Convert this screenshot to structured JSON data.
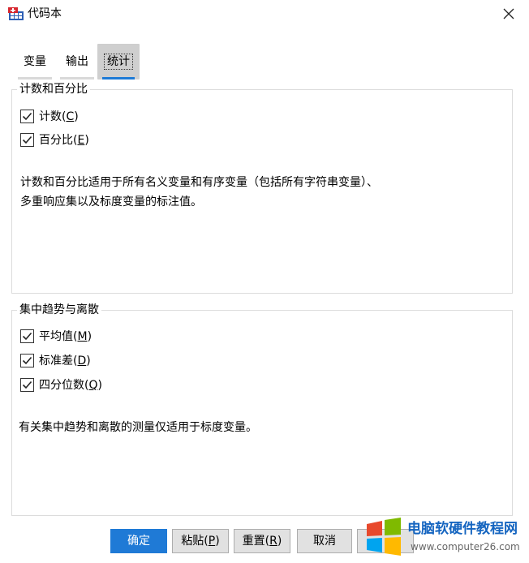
{
  "window": {
    "title": "代码本",
    "icon": "codebook-icon",
    "close_icon": "close-icon"
  },
  "tabs": [
    {
      "label": "变量",
      "active": false
    },
    {
      "label": "输出",
      "active": false
    },
    {
      "label": "统计",
      "active": true
    }
  ],
  "counts_group": {
    "title": "计数和百分比",
    "options": [
      {
        "label": "计数",
        "mnemonic": "C",
        "checked": true
      },
      {
        "label": "百分比",
        "mnemonic": "E",
        "checked": true
      }
    ],
    "description_line1": "计数和百分比适用于所有名义变量和有序变量（包括所有字符串变量）、",
    "description_line2": "多重响应集以及标度变量的标注值。"
  },
  "central_group": {
    "title": "集中趋势与离散",
    "options": [
      {
        "label": "平均值",
        "mnemonic": "M",
        "checked": true
      },
      {
        "label": "标准差",
        "mnemonic": "D",
        "checked": true
      },
      {
        "label": "四分位数",
        "mnemonic": "Q",
        "checked": true
      }
    ],
    "description": "有关集中趋势和离散的测量仅适用于标度变量。"
  },
  "buttons": {
    "ok": "确定",
    "paste_label": "粘贴",
    "paste_mnemonic": "P",
    "reset_label": "重置",
    "reset_mnemonic": "R",
    "cancel": "取消"
  },
  "watermark": {
    "text": "电脑软硬件教程网",
    "url": "www.computer26.com"
  },
  "colors": {
    "accent": "#1f7ad6",
    "active_tab_bg": "#cfcfcf"
  }
}
